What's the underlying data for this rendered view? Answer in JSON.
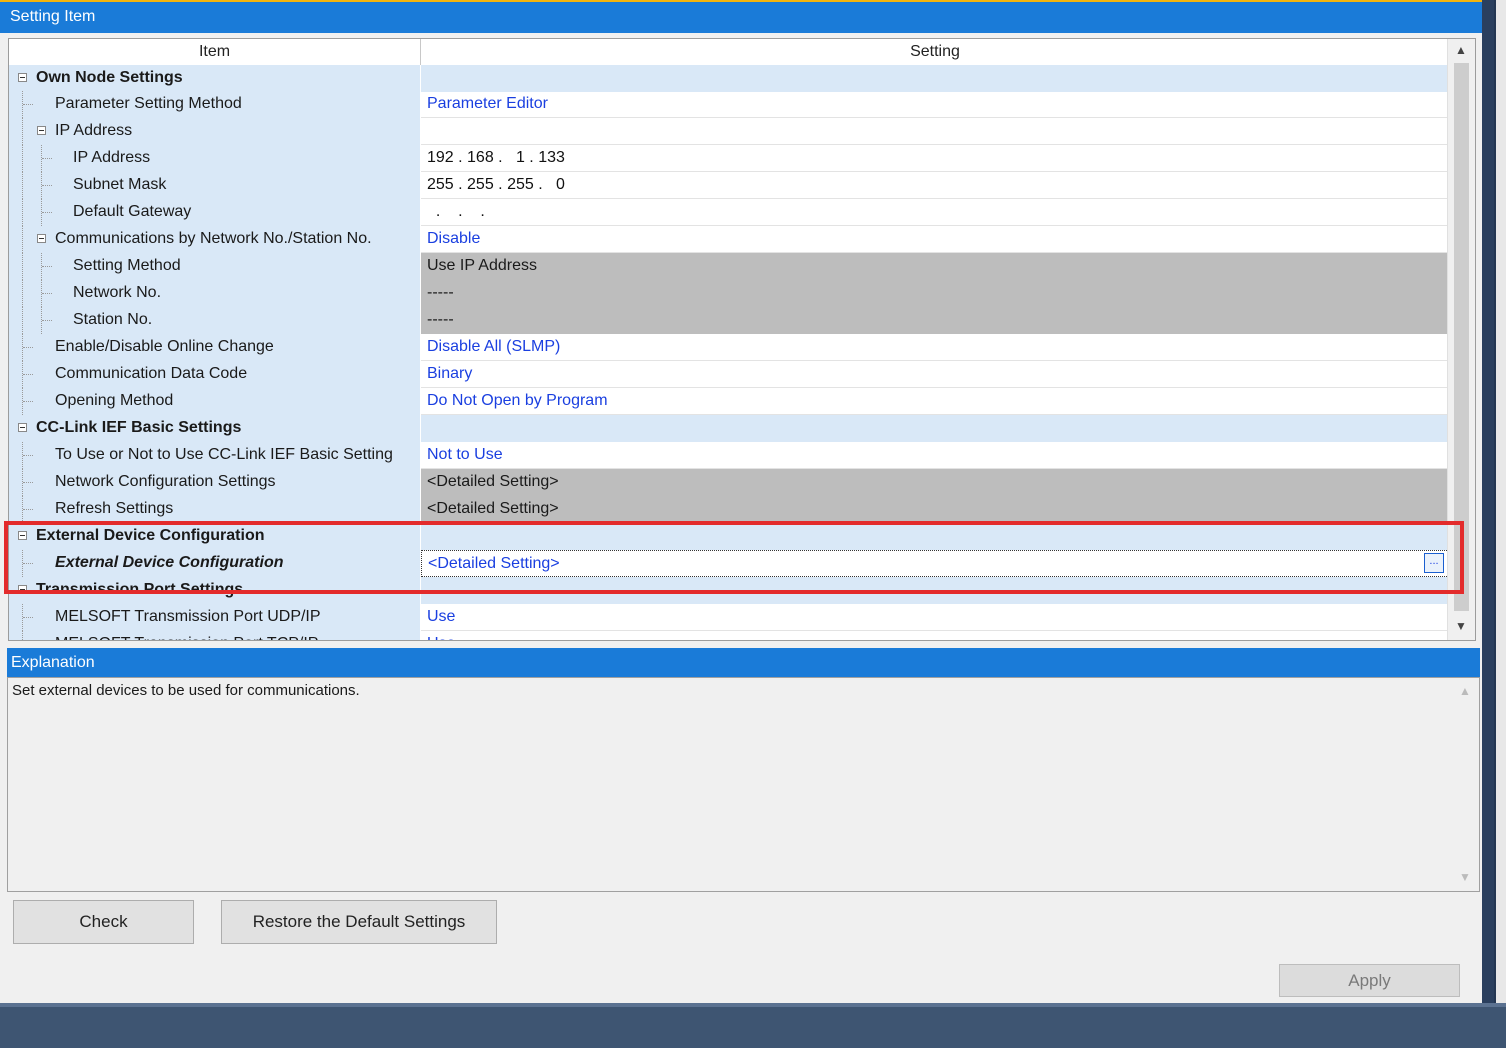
{
  "panel_title": "Setting Item",
  "grid": {
    "col_item": "Item",
    "col_setting": "Setting",
    "rows": [
      {
        "level": 0,
        "group": true,
        "label": "Own Node Settings",
        "value": ""
      },
      {
        "level": 1,
        "label": "Parameter Setting Method",
        "value": "Parameter Editor",
        "style": "link"
      },
      {
        "level": 1,
        "group_sub": true,
        "label": "IP Address",
        "value": ""
      },
      {
        "level": 2,
        "label": "IP Address",
        "value": "192 . 168 .   1 . 133",
        "style": "plain"
      },
      {
        "level": 2,
        "label": "Subnet Mask",
        "value": "255 . 255 . 255 .   0",
        "style": "plain"
      },
      {
        "level": 2,
        "label": "Default Gateway",
        "value": "  .    .    .",
        "style": "plain"
      },
      {
        "level": 1,
        "group_sub": true,
        "label": "Communications by Network No./Station No.",
        "value": "Disable",
        "style": "link"
      },
      {
        "level": 2,
        "label": "Setting Method",
        "value": "Use IP Address",
        "style": "gray"
      },
      {
        "level": 2,
        "label": "Network No.",
        "value": "-----",
        "style": "gray"
      },
      {
        "level": 2,
        "label": "Station No.",
        "value": "-----",
        "style": "gray"
      },
      {
        "level": 1,
        "label": "Enable/Disable Online Change",
        "value": "Disable All (SLMP)",
        "style": "link"
      },
      {
        "level": 1,
        "label": "Communication Data Code",
        "value": "Binary",
        "style": "link"
      },
      {
        "level": 1,
        "label": "Opening Method",
        "value": "Do Not Open by Program",
        "style": "link"
      },
      {
        "level": 0,
        "group": true,
        "label": "CC-Link IEF Basic Settings",
        "value": ""
      },
      {
        "level": 1,
        "label": "To Use or Not to Use CC-Link IEF Basic Setting",
        "value": "Not to Use",
        "style": "link"
      },
      {
        "level": 1,
        "label": "Network Configuration Settings",
        "value": "<Detailed Setting>",
        "style": "gray"
      },
      {
        "level": 1,
        "label": "Refresh Settings",
        "value": "<Detailed Setting>",
        "style": "gray"
      },
      {
        "level": 0,
        "group": true,
        "label": "External Device Configuration",
        "value": ""
      },
      {
        "level": 1,
        "selected": true,
        "label": "External Device Configuration",
        "value": "<Detailed Setting>",
        "style": "link"
      },
      {
        "level": 0,
        "group": true,
        "label": "Transmission Port Settings",
        "value": ""
      },
      {
        "level": 1,
        "label": "MELSOFT Transmission Port UDP/IP",
        "value": "Use",
        "style": "link"
      },
      {
        "level": 1,
        "label": "MELSOFT Transmission Port TCP/IP",
        "value": "Use",
        "style": "link"
      }
    ],
    "ellipsis_label": "..."
  },
  "explanation": {
    "title": "Explanation",
    "text": "Set external devices to be used for communications."
  },
  "buttons": {
    "check": "Check",
    "restore": "Restore the Default Settings",
    "apply": "Apply"
  },
  "icons": {
    "collapse": "collapse-icon",
    "scroll_up": "scroll-up-icon",
    "scroll_down": "scroll-down-icon",
    "ellipsis": "ellipsis-button"
  },
  "colors": {
    "header_blue": "#1a7bd8",
    "link_blue": "#1a3fe0",
    "group_bg": "#d9e8f7",
    "disabled_gray": "#bdbdbd",
    "highlight_red": "#e32b2b"
  }
}
